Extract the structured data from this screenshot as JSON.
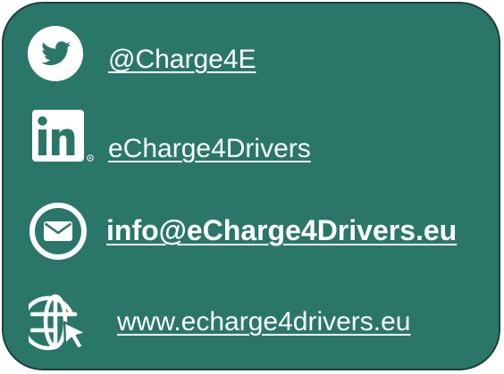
{
  "contacts": {
    "twitter": {
      "icon": "twitter-icon",
      "label": "@Charge4E"
    },
    "linkedin": {
      "icon": "linkedin-icon",
      "label": "eCharge4Drivers"
    },
    "email": {
      "icon": "email-icon",
      "label": "info@eCharge4Drivers.eu"
    },
    "website": {
      "icon": "globe-cursor-icon",
      "label": "www.echarge4drivers.eu"
    }
  },
  "colors": {
    "background": "#2a7769",
    "border": "#1f3f3a",
    "text": "#ffffff"
  }
}
